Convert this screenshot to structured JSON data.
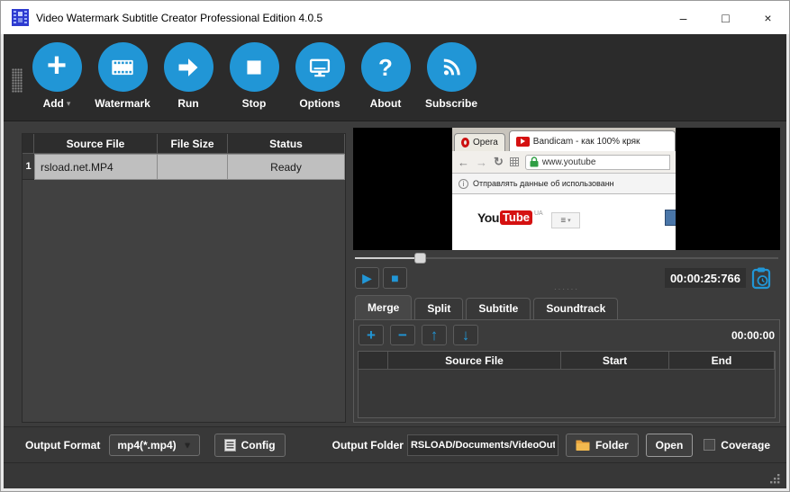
{
  "window": {
    "title": "Video Watermark Subtitle Creator Professional Edition 4.0.5",
    "controls": {
      "minimize": "–",
      "maximize": "□",
      "close": "×"
    }
  },
  "toolbar": {
    "add_caret": "▾",
    "buttons": [
      {
        "label": "Add",
        "icon": "plus-icon"
      },
      {
        "label": "Watermark",
        "icon": "film-icon"
      },
      {
        "label": "Run",
        "icon": "arrow-right-icon"
      },
      {
        "label": "Stop",
        "icon": "stop-square-icon"
      },
      {
        "label": "Options",
        "icon": "monitor-icon"
      },
      {
        "label": "About",
        "icon": "question-icon"
      },
      {
        "label": "Subscribe",
        "icon": "rss-icon"
      }
    ],
    "plus_glyph": "+",
    "question_glyph": "?"
  },
  "file_table": {
    "headers": [
      "Source File",
      "File Size",
      "Status"
    ],
    "rows": [
      {
        "index": "1",
        "source_file": "rsload.net.MP4",
        "file_size": "",
        "status": "Ready"
      }
    ]
  },
  "preview": {
    "browser": {
      "tab_opera": "Opera",
      "tab_active": "Bandicam - как 100% кряк",
      "nav_back": "←",
      "nav_forward": "→",
      "nav_reload": "↻",
      "address": "www.youtube",
      "info_icon_glyph": "i",
      "infobar": "Отправлять данные об использованн",
      "logo_you": "You",
      "logo_tube": "Tube",
      "region": "UA",
      "menu_glyph": "≡",
      "menu_caret": "▾"
    },
    "play_glyph": "▶",
    "stop_glyph": "■",
    "timestamp": "00:00:25:766",
    "divider_dots": "······"
  },
  "tabs": [
    {
      "label": "Merge"
    },
    {
      "label": "Split"
    },
    {
      "label": "Subtitle"
    },
    {
      "label": "Soundtrack"
    }
  ],
  "merge_panel": {
    "add_glyph": "+",
    "remove_glyph": "−",
    "up_glyph": "↑",
    "down_glyph": "↓",
    "time": "00:00:00",
    "headers": [
      "Source File",
      "Start",
      "End"
    ]
  },
  "bottom_bar": {
    "output_format_label": "Output Format",
    "format_value": "mp4(*.mp4)",
    "format_caret": "▼",
    "config_label": "Config",
    "output_folder_label": "Output Folder",
    "folder_path": "RSLOAD/Documents/VideoOutput",
    "folder_button": "Folder",
    "open_button": "Open",
    "coverage_label": "Coverage"
  },
  "colors": {
    "accent_blue": "#2196d6",
    "toolbar_bg": "#2b2b2b",
    "main_bg": "#3c3c3c",
    "selected_row": "#bfbfbf",
    "youtube_red": "#d51111",
    "folder_yellow": "#e8a33d",
    "lock_green": "#2f9e44"
  }
}
